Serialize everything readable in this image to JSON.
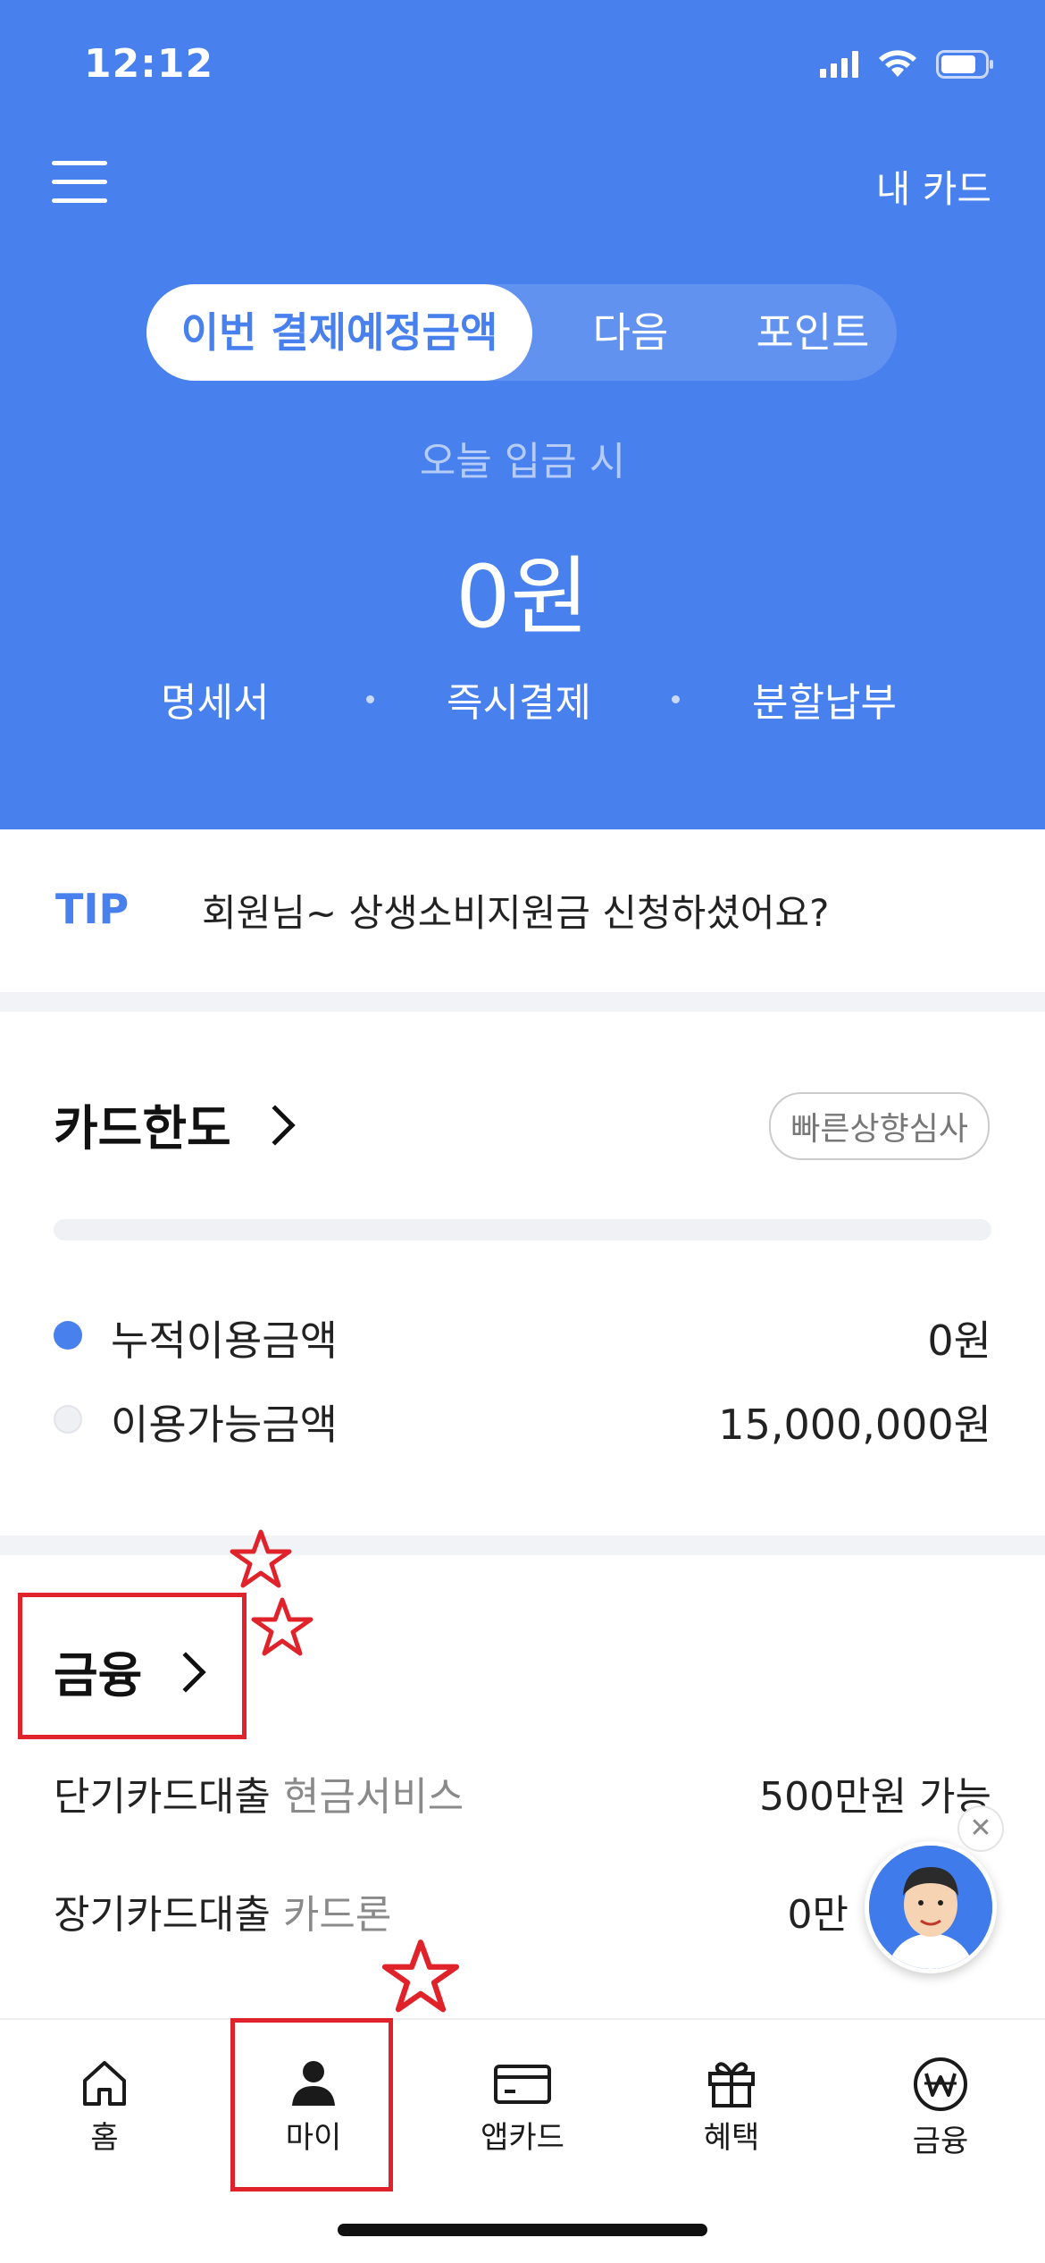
{
  "status_bar": {
    "time": "12:12"
  },
  "header": {
    "my_card_label": "내 카드",
    "tabs": [
      "이번 결제예정금액",
      "다음",
      "포인트"
    ],
    "today_label": "오늘 입금 시",
    "amount": "0원",
    "actions": [
      "명세서",
      "즉시결제",
      "분할납부"
    ]
  },
  "tip": {
    "label": "TIP",
    "text": "회원님~ 상생소비지원금 신청하셨어요?"
  },
  "card_limit": {
    "title": "카드한도",
    "badge": "빠른상향심사",
    "rows": [
      {
        "label": "누적이용금액",
        "value": "0원"
      },
      {
        "label": "이용가능금액",
        "value": "15,000,000원"
      }
    ]
  },
  "finance": {
    "title": "금융",
    "rows": [
      {
        "main": "단기카드대출",
        "sub": "현금서비스",
        "value": "500만원 가능"
      },
      {
        "main": "장기카드대출",
        "sub": "카드론",
        "value": "0만"
      }
    ]
  },
  "tabbar": {
    "items": [
      {
        "label": "홈",
        "icon": "home-icon"
      },
      {
        "label": "마이",
        "icon": "person-icon"
      },
      {
        "label": "앱카드",
        "icon": "card-icon"
      },
      {
        "label": "혜택",
        "icon": "gift-icon"
      },
      {
        "label": "금융",
        "icon": "won-icon"
      }
    ]
  },
  "colors": {
    "brand_blue": "#4880ee",
    "annotation_red": "#e0232b"
  }
}
